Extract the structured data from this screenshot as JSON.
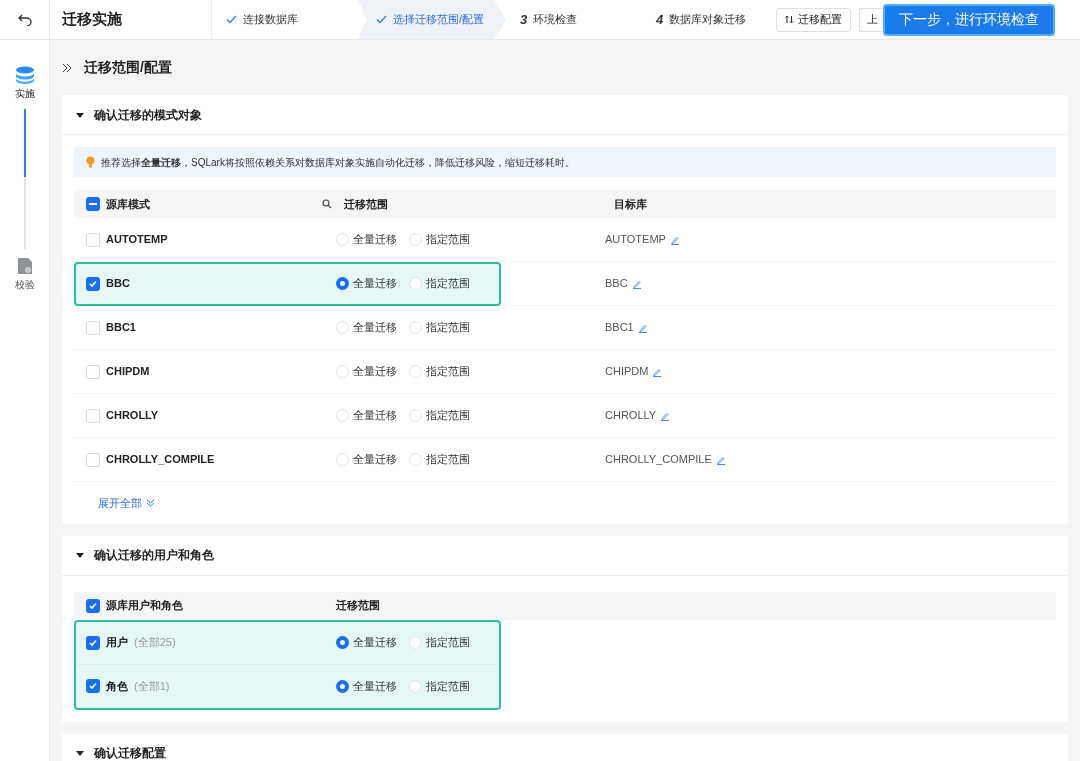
{
  "app": {
    "title": "迁移实施"
  },
  "steps": [
    {
      "label": "连接数据库",
      "kind": "done",
      "selected": false
    },
    {
      "label": "选择迁移范围/配置",
      "kind": "done",
      "selected": true
    },
    {
      "number": "3",
      "label": "环境检查",
      "kind": "numbered",
      "selected": false
    },
    {
      "number": "4",
      "label": "数据库对象迁移",
      "kind": "numbered",
      "selected": false
    }
  ],
  "toolbar": {
    "config_button": "迁移配置",
    "prev_button": "上",
    "next_button": "下一步，进行环境检查"
  },
  "side_nav": [
    {
      "label": "实施",
      "selected": true
    },
    {
      "label": "校验",
      "selected": false
    }
  ],
  "page_title": "迁移范围/配置",
  "schema_section": {
    "title": "确认迁移的模式对象",
    "expanded": true,
    "tip": "推荐选择**全量迁移**，SQLark将按照依赖关系对数据库对象实施自动化迁移，降低迁移风险，缩短迁移耗时。",
    "columns": [
      "源库模式",
      "迁移范围",
      "目标库"
    ],
    "select_all": {
      "checked": false,
      "indeterminate": true
    },
    "rows": [
      {
        "name": "AUTOTEMP",
        "checked": false,
        "highlighted": false,
        "options": [
          {
            "label": "全量迁移",
            "selected": false
          },
          {
            "label": "指定范围",
            "selected": false
          }
        ],
        "target": "AUTOTEMP"
      },
      {
        "name": "BBC",
        "checked": true,
        "highlighted": true,
        "options": [
          {
            "label": "全量迁移",
            "selected": true
          },
          {
            "label": "指定范围",
            "selected": false
          }
        ],
        "target": "BBC"
      },
      {
        "name": "BBC1",
        "checked": false,
        "highlighted": false,
        "options": [
          {
            "label": "全量迁移",
            "selected": false
          },
          {
            "label": "指定范围",
            "selected": false
          }
        ],
        "target": "BBC1"
      },
      {
        "name": "CHIPDM",
        "checked": false,
        "highlighted": false,
        "options": [
          {
            "label": "全量迁移",
            "selected": false
          },
          {
            "label": "指定范围",
            "selected": false
          }
        ],
        "target": "CHIPDM"
      },
      {
        "name": "CHROLLY",
        "checked": false,
        "highlighted": false,
        "options": [
          {
            "label": "全量迁移",
            "selected": false
          },
          {
            "label": "指定范围",
            "selected": false
          }
        ],
        "target": "CHROLLY"
      },
      {
        "name": "CHROLLY_COMPILE",
        "checked": false,
        "highlighted": false,
        "options": [
          {
            "label": "全量迁移",
            "selected": false
          },
          {
            "label": "指定范围",
            "selected": false
          }
        ],
        "target": "CHROLLY_COMPILE"
      }
    ],
    "expand_link": "展开全部"
  },
  "user_section": {
    "title": "确认迁移的用户和角色",
    "expanded": true,
    "columns": [
      "源库用户和角色",
      "迁移范围"
    ],
    "select_all": {
      "checked": true
    },
    "highlighted": true,
    "rows": [
      {
        "name": "用户",
        "count": "(全部25)",
        "checked": true,
        "options": [
          {
            "label": "全量迁移",
            "selected": true
          },
          {
            "label": "指定范围",
            "selected": false
          }
        ]
      },
      {
        "name": "角色",
        "count": "(全部1)",
        "checked": true,
        "options": [
          {
            "label": "全量迁移",
            "selected": true
          },
          {
            "label": "指定范围",
            "selected": false
          }
        ]
      }
    ]
  },
  "config_section": {
    "title": "确认迁移配置",
    "expanded": true
  }
}
